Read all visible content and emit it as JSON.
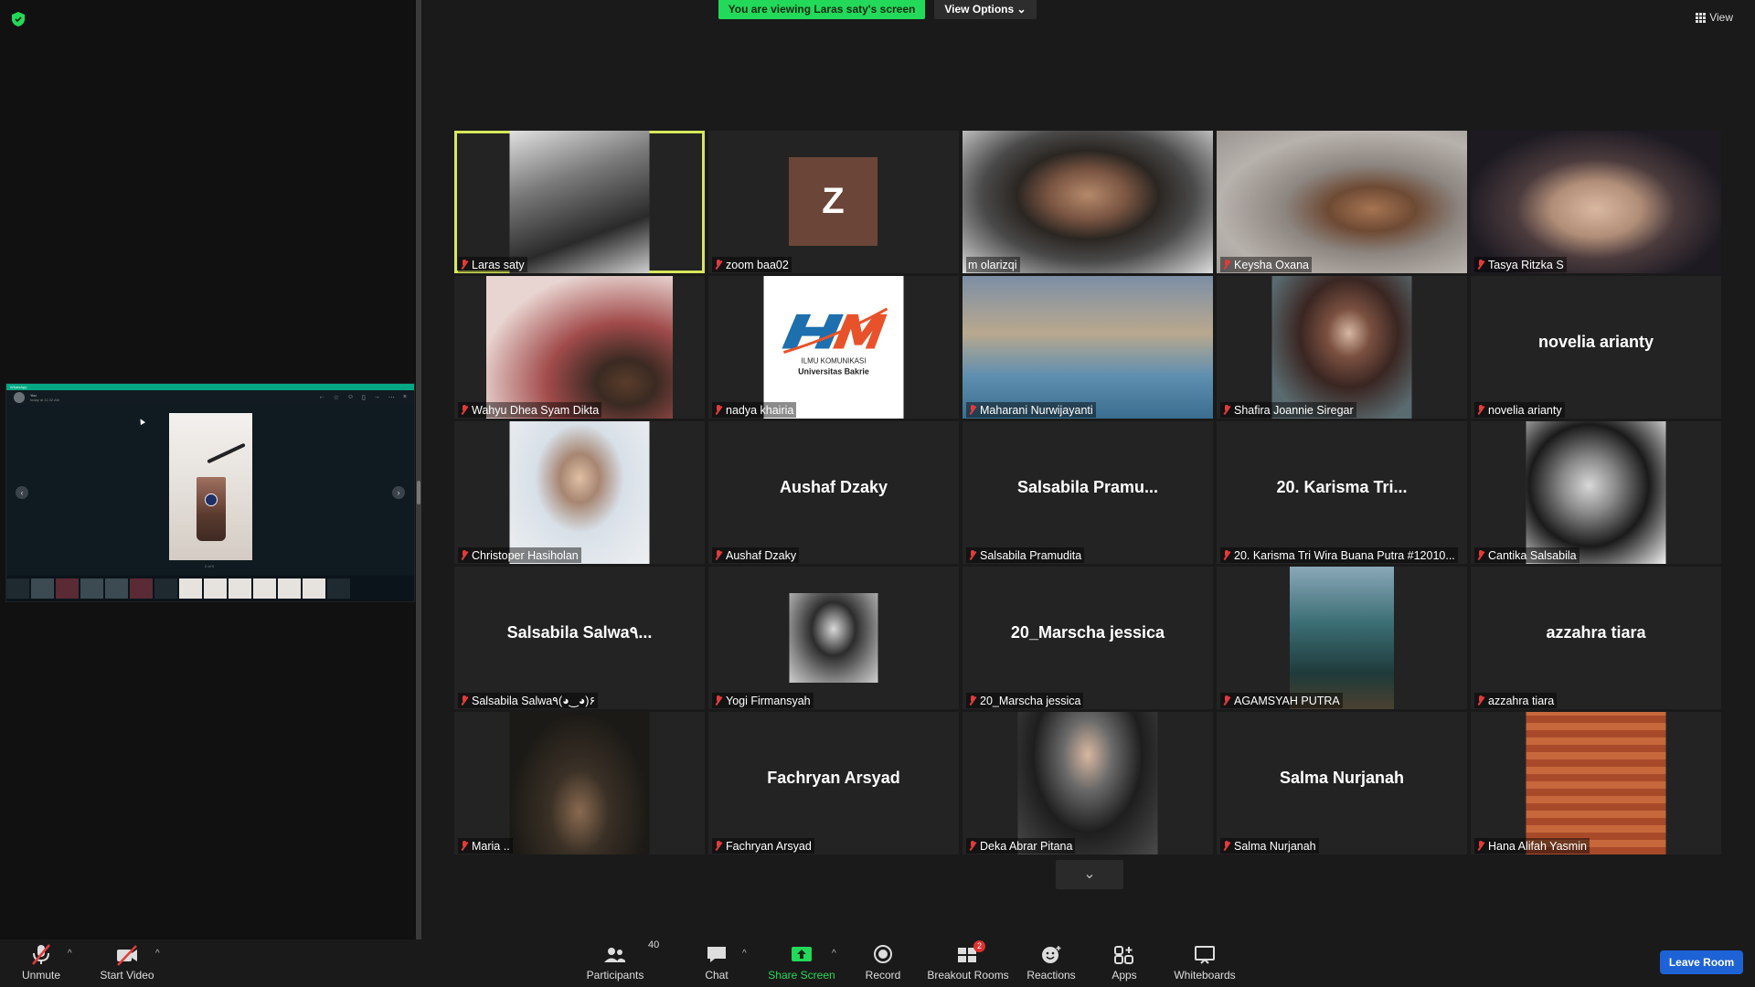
{
  "banner": {
    "viewing_text": "You are viewing Laras saty's screen",
    "view_options_label": "View Options",
    "view_label": "View"
  },
  "shared_window": {
    "app_title": "WhatsApp",
    "contact_name": "You",
    "contact_sub": "today at 11:32 AM",
    "caption": "2 of 9"
  },
  "gallery": {
    "tiles": [
      {
        "name": "Laras saty",
        "display": "video",
        "muted": true
      },
      {
        "name": "zoom baa02",
        "display": "avatar",
        "initial": "Z",
        "muted": true
      },
      {
        "name": "m olarizqi",
        "display": "video",
        "muted": false
      },
      {
        "name": "Keysha Oxana",
        "display": "video",
        "muted": true
      },
      {
        "name": "Tasya Ritzka S",
        "display": "video",
        "muted": true
      },
      {
        "name": "Wahyu Dhea Syam Dikta",
        "display": "video",
        "muted": true
      },
      {
        "name": "nadya khairia",
        "display": "image",
        "muted": true,
        "logo_text_1": "ILMU KOMUNIKASI",
        "logo_text_2": "Universitas Bakrie"
      },
      {
        "name": "Maharani Nurwijayanti",
        "display": "video",
        "muted": true
      },
      {
        "name": "Shafira Joannie Siregar",
        "display": "video",
        "muted": true
      },
      {
        "name": "novelia arianty",
        "display": "name",
        "bigname": "novelia arianty",
        "muted": true
      },
      {
        "name": "Christoper Hasiholan",
        "display": "video",
        "muted": true
      },
      {
        "name": "Aushaf Dzaky",
        "display": "name",
        "bigname": "Aushaf Dzaky",
        "muted": true
      },
      {
        "name": "Salsabila Pramudita",
        "display": "name",
        "bigname": "Salsabila Pramu...",
        "muted": true
      },
      {
        "name": "20. Karisma Tri Wira Buana Putra #12010...",
        "display": "name",
        "bigname": "20. Karisma Tri...",
        "muted": true
      },
      {
        "name": "Cantika Salsabila",
        "display": "video",
        "muted": true
      },
      {
        "name": "Salsabila Salwa٩(◕‿◕)۶",
        "display": "name",
        "bigname": "Salsabila Salwa٩...",
        "muted": true
      },
      {
        "name": "Yogi Firmansyah",
        "display": "video",
        "muted": true
      },
      {
        "name": "20_Marscha jessica",
        "display": "name",
        "bigname": "20_Marscha jessica",
        "muted": true
      },
      {
        "name": "AGAMSYAH PUTRA",
        "display": "video",
        "muted": true
      },
      {
        "name": "azzahra tiara",
        "display": "name",
        "bigname": "azzahra tiara",
        "muted": true
      },
      {
        "name": "Maria ..",
        "display": "video",
        "muted": true
      },
      {
        "name": "Fachryan Arsyad",
        "display": "name",
        "bigname": "Fachryan Arsyad",
        "muted": true
      },
      {
        "name": "Deka Abrar Pitana",
        "display": "video",
        "muted": true
      },
      {
        "name": "Salma Nurjanah",
        "display": "name",
        "bigname": "Salma Nurjanah",
        "muted": true
      },
      {
        "name": "Hana Alifah Yasmin",
        "display": "video",
        "muted": true
      }
    ]
  },
  "toolbar": {
    "unmute": "Unmute",
    "start_video": "Start Video",
    "participants": "Participants",
    "participants_count": "40",
    "chat": "Chat",
    "share_screen": "Share Screen",
    "record": "Record",
    "breakout_rooms": "Breakout Rooms",
    "breakout_badge": "2",
    "reactions": "Reactions",
    "apps": "Apps",
    "whiteboards": "Whiteboards",
    "leave": "Leave Room"
  },
  "colors": {
    "accent_green": "#23d959",
    "active_speaker": "#d6e85b",
    "leave_blue": "#1e63d6",
    "mute_red": "#e23b3b"
  }
}
